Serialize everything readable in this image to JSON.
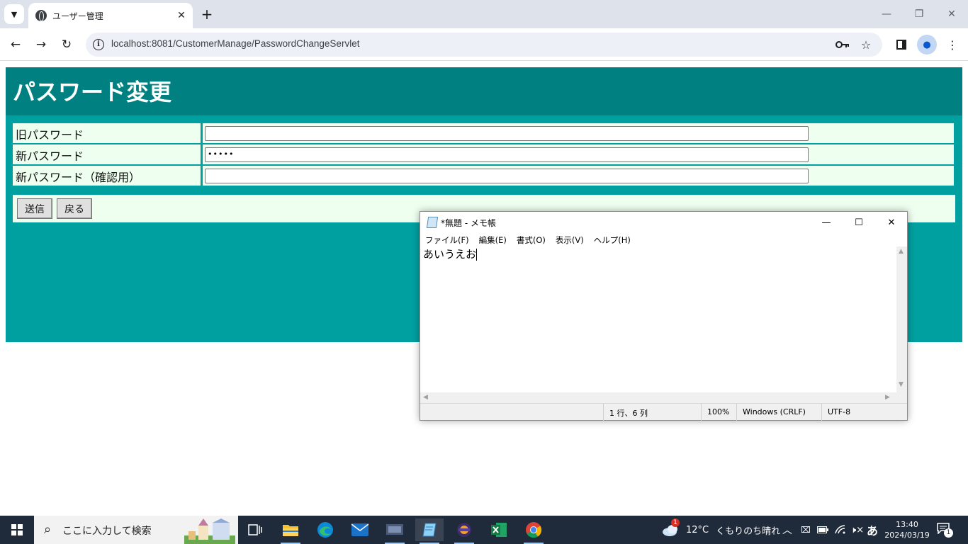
{
  "browser": {
    "tab_title": "ユーザー管理",
    "tab_close": "✕",
    "new_tab": "+",
    "url": "localhost:8081/CustomerManage/PasswordChangeServlet",
    "window_min": "—",
    "window_restore": "❐",
    "window_close": "✕"
  },
  "page": {
    "title": "パスワード変更",
    "fields": [
      {
        "label": "旧パスワード",
        "value": ""
      },
      {
        "label": "新パスワード",
        "value": "•••••"
      },
      {
        "label": "新パスワード（確認用）",
        "value": ""
      }
    ],
    "submit_label": "送信",
    "back_label": "戻る"
  },
  "notepad": {
    "title": "*無題 - メモ帳",
    "menu": [
      "ファイル(F)",
      "編集(E)",
      "書式(O)",
      "表示(V)",
      "ヘルプ(H)"
    ],
    "content": "あいうえお",
    "status_position": "1 行、6 列",
    "status_zoom": "100%",
    "status_eol": "Windows (CRLF)",
    "status_encoding": "UTF-8"
  },
  "taskbar": {
    "search_placeholder": "ここに入力して検索",
    "weather_badge": "1",
    "weather_temp": "12°C",
    "weather_text": "くもりのち晴れ",
    "ime": "あ",
    "time": "13:40",
    "date": "2024/03/19",
    "notification_count": "1"
  },
  "colors": {
    "page_bg": "#00a0a0",
    "header_bg": "#008080",
    "cell_bg": "#eefff0"
  }
}
